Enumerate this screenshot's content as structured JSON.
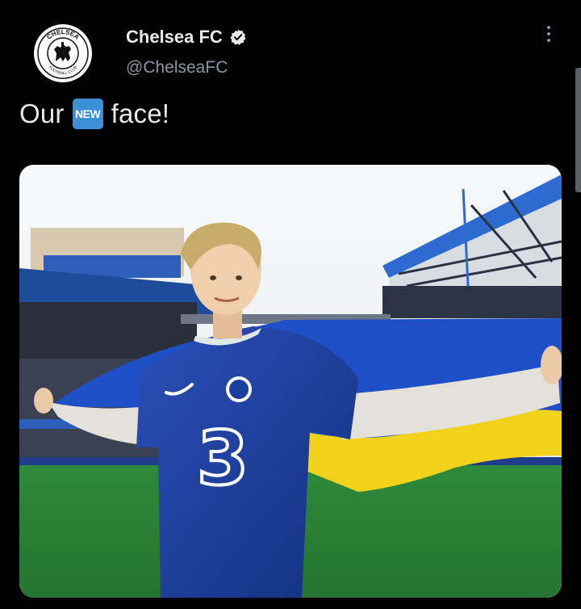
{
  "tweet": {
    "author": {
      "name": "Chelsea FC",
      "handle": "@ChelseaFC",
      "verified": true,
      "avatar_icon": "chelsea-crest-icon",
      "avatar_text_top": "CHELSEA",
      "avatar_text_bottom": "FOOTBALL CLUB"
    },
    "more_icon": "more-options-icon",
    "text_before": "Our",
    "badge_label": "NEW",
    "text_after": "face!",
    "media": {
      "type": "photo",
      "jersey_number_text": "3"
    }
  },
  "colors": {
    "background": "#000000",
    "text": "#e7e9ea",
    "secondary_text": "#8b98a5",
    "badge": "#3c8fd6",
    "jersey_blue": "#1b3fa0",
    "flag_blue": "#1f4fc7",
    "flag_yellow": "#f2d21a",
    "pitch_green": "#2f8a3a"
  }
}
